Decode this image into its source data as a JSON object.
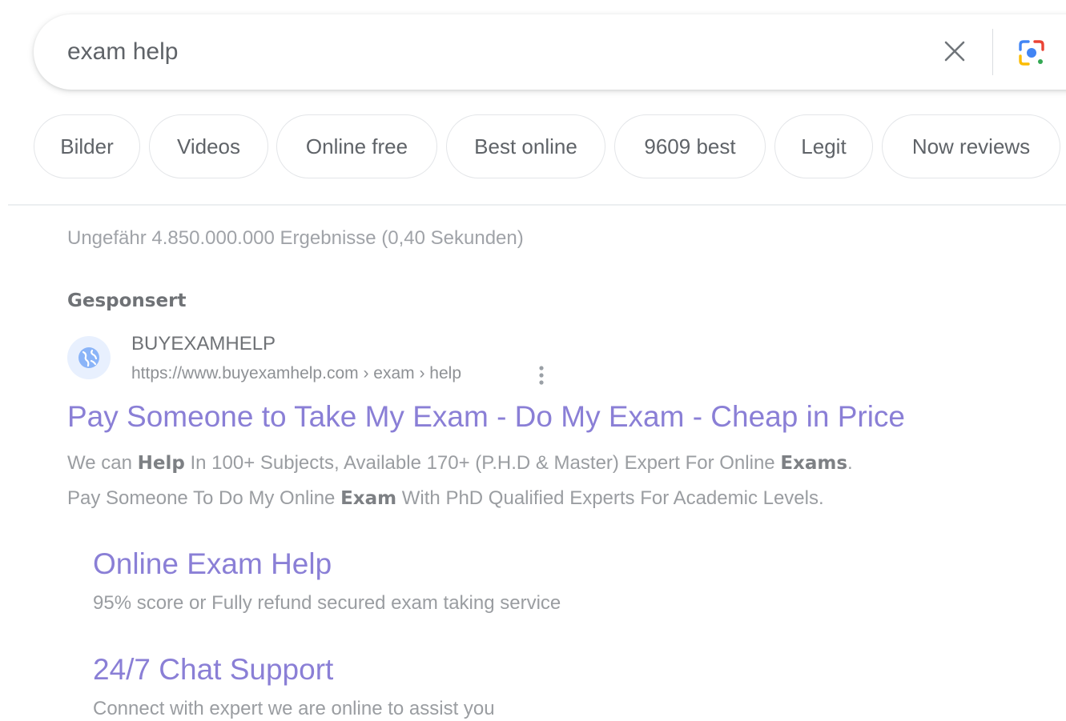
{
  "search": {
    "query": "exam help"
  },
  "chips": [
    {
      "label": "Bilder"
    },
    {
      "label": "Videos"
    },
    {
      "label": "Online free"
    },
    {
      "label": "Best online"
    },
    {
      "label": "9609 best"
    },
    {
      "label": "Legit"
    },
    {
      "label": "Now reviews"
    }
  ],
  "results": {
    "stats": "Ungefähr 4.850.000.000 Ergebnisse (0,40 Sekunden)",
    "sponsored_label": "Gesponsert",
    "ad": {
      "site_name": "BUYEXAMHELP",
      "url": "https://www.buyexamhelp.com › exam › help",
      "title": "Pay Someone to Take My Exam - Do My Exam - Cheap in Price",
      "desc_line1": [
        {
          "text": "We can ",
          "bold": false
        },
        {
          "text": "Help",
          "bold": true
        },
        {
          "text": " In 100+ Subjects, Available 170+ (P.H.D & Master) Expert For Online ",
          "bold": false
        },
        {
          "text": "Exams",
          "bold": true
        },
        {
          "text": ".",
          "bold": false
        }
      ],
      "desc_line2": [
        {
          "text": "Pay Someone To Do My Online ",
          "bold": false
        },
        {
          "text": "Exam",
          "bold": true
        },
        {
          "text": " With PhD Qualified Experts For Academic Levels.",
          "bold": false
        }
      ]
    },
    "sitelinks": [
      {
        "title": "Online Exam Help",
        "desc": "95% score or Fully refund secured exam taking service"
      },
      {
        "title": "24/7 Chat Support",
        "desc": "Connect with expert we are online to assist you"
      }
    ]
  },
  "colors": {
    "link": "#8a7fd6",
    "muted_text": "#9a9da1",
    "lens_blue": "#4285f4",
    "lens_red": "#ea4335",
    "lens_yellow": "#fbbc04",
    "lens_green": "#34a853"
  },
  "icons": {
    "clear": "close-icon",
    "lens": "google-lens-icon",
    "favicon": "globe-icon",
    "more": "more-vertical-icon"
  }
}
